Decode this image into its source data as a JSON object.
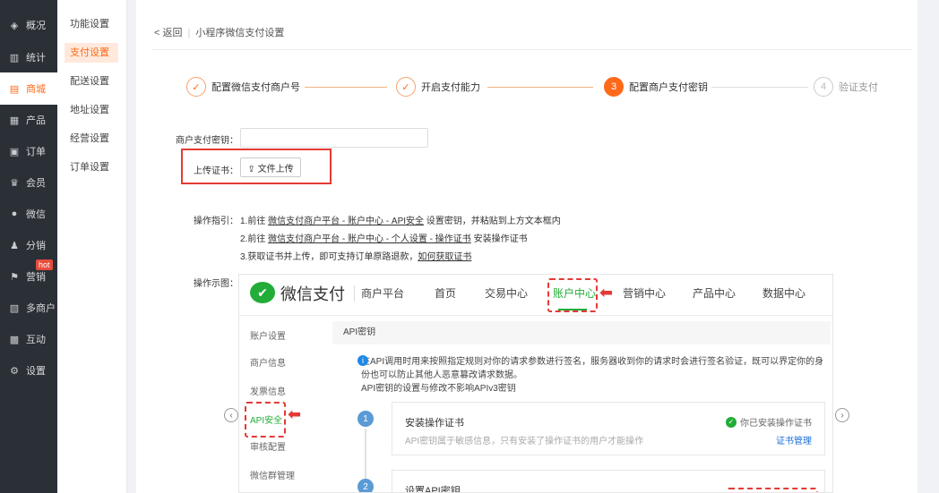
{
  "sidebar": {
    "items": [
      {
        "label": "概况",
        "icon": "layers-icon"
      },
      {
        "label": "统计",
        "icon": "chart-icon"
      },
      {
        "label": "商城",
        "icon": "store-icon"
      },
      {
        "label": "产品",
        "icon": "grid-icon"
      },
      {
        "label": "订单",
        "icon": "order-icon"
      },
      {
        "label": "会员",
        "icon": "crown-icon"
      },
      {
        "label": "微信",
        "icon": "wechat-icon"
      },
      {
        "label": "分销",
        "icon": "users-icon"
      },
      {
        "label": "营销",
        "icon": "flag-icon"
      },
      {
        "label": "多商户",
        "icon": "shop-icon"
      },
      {
        "label": "互动",
        "icon": "interact-icon"
      },
      {
        "label": "设置",
        "icon": "gear-icon"
      }
    ],
    "active_index": 2,
    "hot_badge": "hot"
  },
  "subnav": {
    "items": [
      "功能设置",
      "支付设置",
      "配送设置",
      "地址设置",
      "经营设置",
      "订单设置"
    ],
    "active_index": 1
  },
  "header": {
    "back_label": "< 返回",
    "title": "小程序微信支付设置"
  },
  "steps": [
    {
      "num": "✓",
      "label": "配置微信支付商户号",
      "status": "done"
    },
    {
      "num": "✓",
      "label": "开启支付能力",
      "status": "done"
    },
    {
      "num": "3",
      "label": "配置商户支付密钥",
      "status": "current"
    },
    {
      "num": "4",
      "label": "验证支付",
      "status": "todo"
    }
  ],
  "form": {
    "key_label": "商户支付密钥：",
    "key_value": "",
    "upload_label": "上传证书：",
    "upload_button": "⇪ 文件上传"
  },
  "guide": {
    "label": "操作指引：",
    "line1_prefix": "1.前往 ",
    "line1_link": "微信支付商户平台 - 账户中心 - API安全",
    "line1_suffix": " 设置密钥，并粘贴到上方文本框内",
    "line2_prefix": "2.前往 ",
    "line2_link": "微信支付商户平台 - 账户中心 - 个人设置 - 操作证书",
    "line2_suffix": " 安装操作证书",
    "line3_prefix": "3.获取证书并上传，即可支持订单原路退款，",
    "line3_link": "如何获取证书"
  },
  "demo": {
    "label": "操作示图：",
    "brand": "微信支付",
    "platform": "商户平台",
    "nav": [
      "首页",
      "交易中心",
      "账户中心",
      "营销中心",
      "产品中心",
      "数据中心"
    ],
    "nav_active_index": 2,
    "left_menu": [
      "账户设置",
      "商户信息",
      "发票信息",
      "API安全",
      "审核配置",
      "微信群管理"
    ],
    "left_active_index": 3,
    "panel_title": "API密钥",
    "info_line1": "在API调用时用来按照指定规则对你的请求参数进行签名，服务器收到你的请求时会进行签名验证，既可以界定你的身",
    "info_line2": "份也可以防止其他人恶意篡改请求数据。",
    "info_line3": "API密钥的设置与修改不影响APIv3密钥",
    "card1_num": "1",
    "card1_title": "安装操作证书",
    "card1_desc": "API密钥属于敏感信息，只有安装了操作证书的用户才能操作",
    "card1_status": "你已安装操作证书",
    "card1_link": "证书管理",
    "card2_num": "2",
    "card2_title": "设置API密钥"
  },
  "colors": {
    "accent": "#ff6a1a",
    "wechat_green": "#22ac38",
    "highlight_red": "#e53935"
  }
}
